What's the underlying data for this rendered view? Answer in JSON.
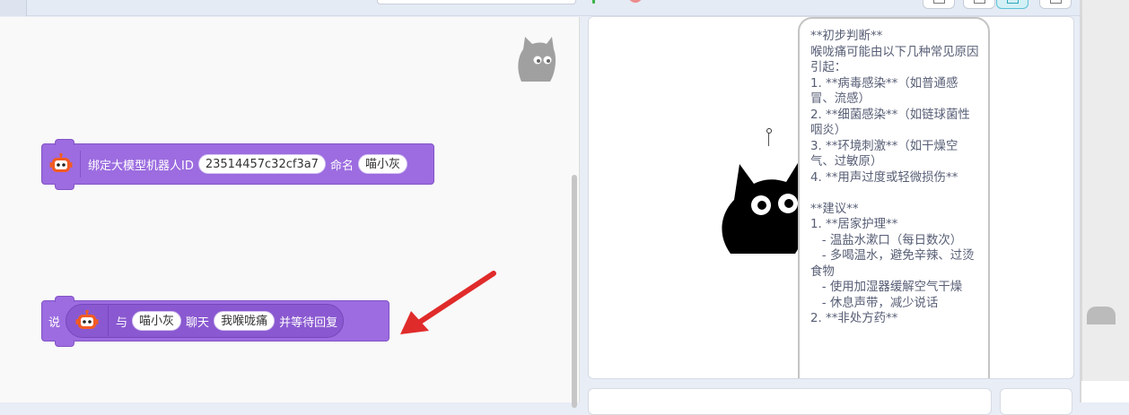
{
  "blocks": {
    "bind": {
      "label": "绑定大模型机器人ID",
      "robot_id": "23514457c32cf3a7",
      "name_label": "命名",
      "name_value": "喵小灰"
    },
    "say": {
      "say_label": "说",
      "with_label": "与",
      "robot_name": "喵小灰",
      "chat_label": "聊天",
      "message": "我喉咙痛",
      "wait_label": "并等待回复"
    }
  },
  "stage": {
    "speech_text": "**初步判断**\n喉咙痛可能由以下几种常见原因引起：\n1. **病毒感染**（如普通感冒、流感）\n2. **细菌感染**（如链球菌性咽炎）\n3. **环境刺激**（如干燥空气、过敏原）\n4. **用声过度或轻微损伤**\n\n**建议**\n1. **居家护理**\n   - 温盐水漱口（每日数次）\n   - 多喝温水，避免辛辣、过烫食物\n   - 使用加湿器缓解空气干燥\n   - 休息声带，减少说话\n2. **非处方药**"
  },
  "icons": {
    "robot": "robot-icon",
    "cat": "cat-sprite",
    "arrow": "red-arrow-annotation"
  },
  "colors": {
    "block_purple": "#9c6ce0",
    "arrow_red": "#e02b2b"
  }
}
